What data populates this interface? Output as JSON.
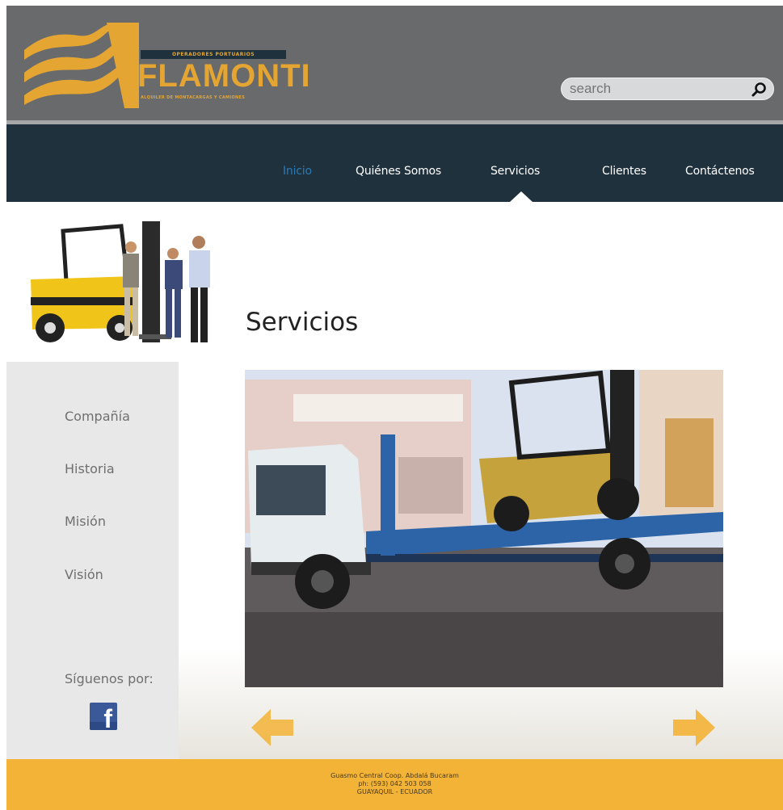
{
  "header": {
    "brand": "FLAMONTI",
    "tagline_top": "OPERADORES PORTUARIOS",
    "tagline_bottom": "ALQUILER DE MONTACARGAS Y CAMIONES",
    "search_placeholder": "search"
  },
  "nav": {
    "items": [
      {
        "label": "Inicio",
        "active": true
      },
      {
        "label": "Quiénes Somos",
        "active": false
      },
      {
        "label": "Servicios",
        "active": false
      },
      {
        "label": "Clientes",
        "active": false
      },
      {
        "label": "Contáctenos",
        "active": false
      }
    ]
  },
  "page": {
    "title": "Servicios"
  },
  "sidebar": {
    "items": [
      {
        "label": "Compañía"
      },
      {
        "label": "Historia"
      },
      {
        "label": "Misión"
      },
      {
        "label": "Visión"
      }
    ],
    "follow_label": "Síguenos por:",
    "facebook_icon": "facebook-icon"
  },
  "footer": {
    "line1": "Guasmo Central Coop. Abdalá Bucaram",
    "line2": "ph: (593) 042 503 058",
    "line3": "GUAYAQUIL - ECUADOR"
  },
  "colors": {
    "header_bg": "#696a6c",
    "nav_bg": "#1f313d",
    "accent": "#e4a532",
    "active_nav": "#2b7ab5",
    "footer_bg": "#f3b336"
  }
}
